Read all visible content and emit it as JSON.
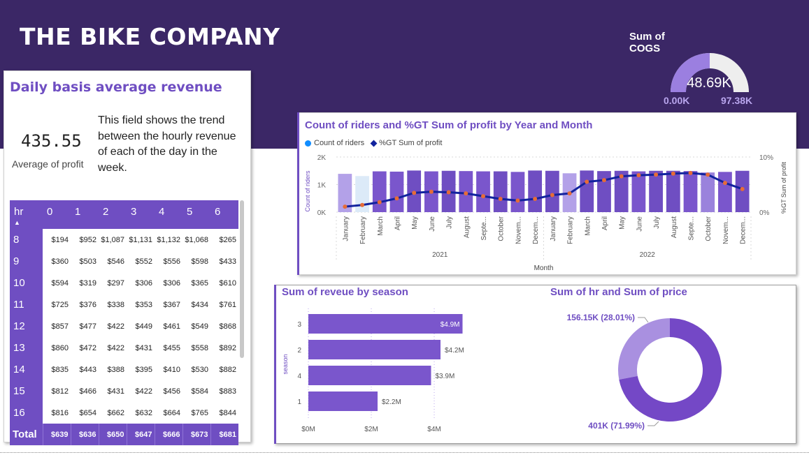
{
  "header": {
    "title": "THE BIKE COMPANY"
  },
  "gauge": {
    "title": "Sum of COGS",
    "value_label": "48.69K",
    "min_label": "0.00K",
    "max_label": "97.38K",
    "value": 48.69,
    "min": 0,
    "max": 97.38,
    "fill_color": "#9b7fe0",
    "track_color": "#eeeeee"
  },
  "revenue_card": {
    "title": "Daily basis average revenue",
    "kpi_value": "435.55",
    "kpi_label": "Average of profit",
    "description": "This field shows the trend between the hourly revenue of each of the day in the week."
  },
  "matrix": {
    "corner_label": "hr",
    "columns": [
      "0",
      "1",
      "2",
      "3",
      "4",
      "5",
      "6"
    ],
    "rows": [
      {
        "hr": "8",
        "values": [
          "$194",
          "$952",
          "$1,087",
          "$1,131",
          "$1,132",
          "$1,068",
          "$265"
        ]
      },
      {
        "hr": "9",
        "values": [
          "$360",
          "$503",
          "$546",
          "$552",
          "$556",
          "$598",
          "$433"
        ]
      },
      {
        "hr": "10",
        "values": [
          "$594",
          "$319",
          "$297",
          "$306",
          "$306",
          "$365",
          "$610"
        ]
      },
      {
        "hr": "11",
        "values": [
          "$725",
          "$376",
          "$338",
          "$353",
          "$367",
          "$434",
          "$761"
        ]
      },
      {
        "hr": "12",
        "values": [
          "$857",
          "$477",
          "$422",
          "$449",
          "$461",
          "$549",
          "$868"
        ]
      },
      {
        "hr": "13",
        "values": [
          "$860",
          "$472",
          "$422",
          "$431",
          "$455",
          "$558",
          "$892"
        ]
      },
      {
        "hr": "14",
        "values": [
          "$835",
          "$443",
          "$388",
          "$395",
          "$410",
          "$530",
          "$882"
        ]
      },
      {
        "hr": "15",
        "values": [
          "$812",
          "$466",
          "$431",
          "$422",
          "$456",
          "$584",
          "$883"
        ]
      },
      {
        "hr": "16",
        "values": [
          "$816",
          "$654",
          "$662",
          "$632",
          "$664",
          "$765",
          "$844"
        ]
      }
    ],
    "total": {
      "label": "Total",
      "values": [
        "$639",
        "$636",
        "$650",
        "$647",
        "$666",
        "$673",
        "$681"
      ]
    }
  },
  "chart_data": [
    {
      "type": "bar",
      "title": "Count of riders and %GT Sum of profit by Year and Month",
      "legend": [
        "Count of riders",
        "%GT Sum of profit"
      ],
      "legend_position": "top-left",
      "xlabel": "Month",
      "ylabel": "Count of riders",
      "y2label": "%GT Sum of profit",
      "ylim": [
        0,
        2000
      ],
      "y_ticks": [
        "0K",
        "1K",
        "2K"
      ],
      "y2_ticks": [
        "0%",
        "10%"
      ],
      "y2lim": [
        0,
        10
      ],
      "years": [
        "2021",
        "2022"
      ],
      "categories": [
        "January",
        "February",
        "March",
        "April",
        "May",
        "June",
        "July",
        "August",
        "September",
        "October",
        "November",
        "December",
        "January",
        "February",
        "March",
        "April",
        "May",
        "June",
        "July",
        "August",
        "September",
        "October",
        "November",
        "December"
      ],
      "category_labels": [
        "January",
        "February",
        "March",
        "April",
        "May",
        "June",
        "July",
        "August",
        "Septe...",
        "October",
        "Novem...",
        "Decem...",
        "January",
        "February",
        "March",
        "April",
        "May",
        "June",
        "July",
        "August",
        "Septe...",
        "October",
        "Novem...",
        "Decem..."
      ],
      "series": [
        {
          "name": "Count of riders",
          "values": [
            1390,
            1310,
            1480,
            1470,
            1510,
            1480,
            1500,
            1490,
            1480,
            1480,
            1460,
            1510,
            1500,
            1410,
            1510,
            1490,
            1500,
            1480,
            1500,
            1500,
            1490,
            1440,
            1460,
            1500
          ]
        },
        {
          "name": "%GT Sum of profit",
          "values": [
            1.0,
            1.3,
            1.8,
            2.5,
            3.5,
            3.7,
            3.6,
            3.4,
            2.9,
            2.4,
            2.1,
            2.4,
            3.1,
            3.4,
            5.5,
            5.8,
            6.5,
            6.7,
            6.8,
            7.0,
            7.1,
            6.8,
            5.3,
            4.2
          ]
        }
      ],
      "bar_colors": [
        "#b3a1e8",
        "#dceaf8",
        "#7a56cc",
        "#7a56cc",
        "#6f4ec2",
        "#7a56cc",
        "#6f4ec2",
        "#7a56cc",
        "#7a56cc",
        "#6f4ec2",
        "#7a56cc",
        "#6f4ec2",
        "#6f4ec2",
        "#b3a1e8",
        "#6f4ec2",
        "#6f4ec2",
        "#6f4ec2",
        "#7a56cc",
        "#6f4ec2",
        "#6f4ec2",
        "#7a56cc",
        "#9a82dc",
        "#7a56cc",
        "#6f4ec2"
      ],
      "line_color": "#12239e",
      "marker_color": "#e66c37"
    },
    {
      "type": "bar",
      "orientation": "horizontal",
      "title": "Sum of reveue by season",
      "ylabel": "season",
      "xlim": [
        0,
        5
      ],
      "x_ticks": [
        "$0M",
        "$2M",
        "$4M"
      ],
      "categories": [
        "3",
        "2",
        "4",
        "1"
      ],
      "values": [
        4.9,
        4.2,
        3.9,
        2.2
      ],
      "data_labels": [
        "$4.9M",
        "$4.2M",
        "$3.9M",
        "$2.2M"
      ],
      "bar_color": "#7a56cc"
    },
    {
      "type": "pie",
      "style": "donut",
      "title": "Sum of hr and Sum of price",
      "values": [
        156.15,
        401
      ],
      "data_labels": [
        "156.15K (28.01%)",
        "401K (71.99%)"
      ],
      "colors": [
        "#a990e0",
        "#7448c6"
      ]
    }
  ]
}
